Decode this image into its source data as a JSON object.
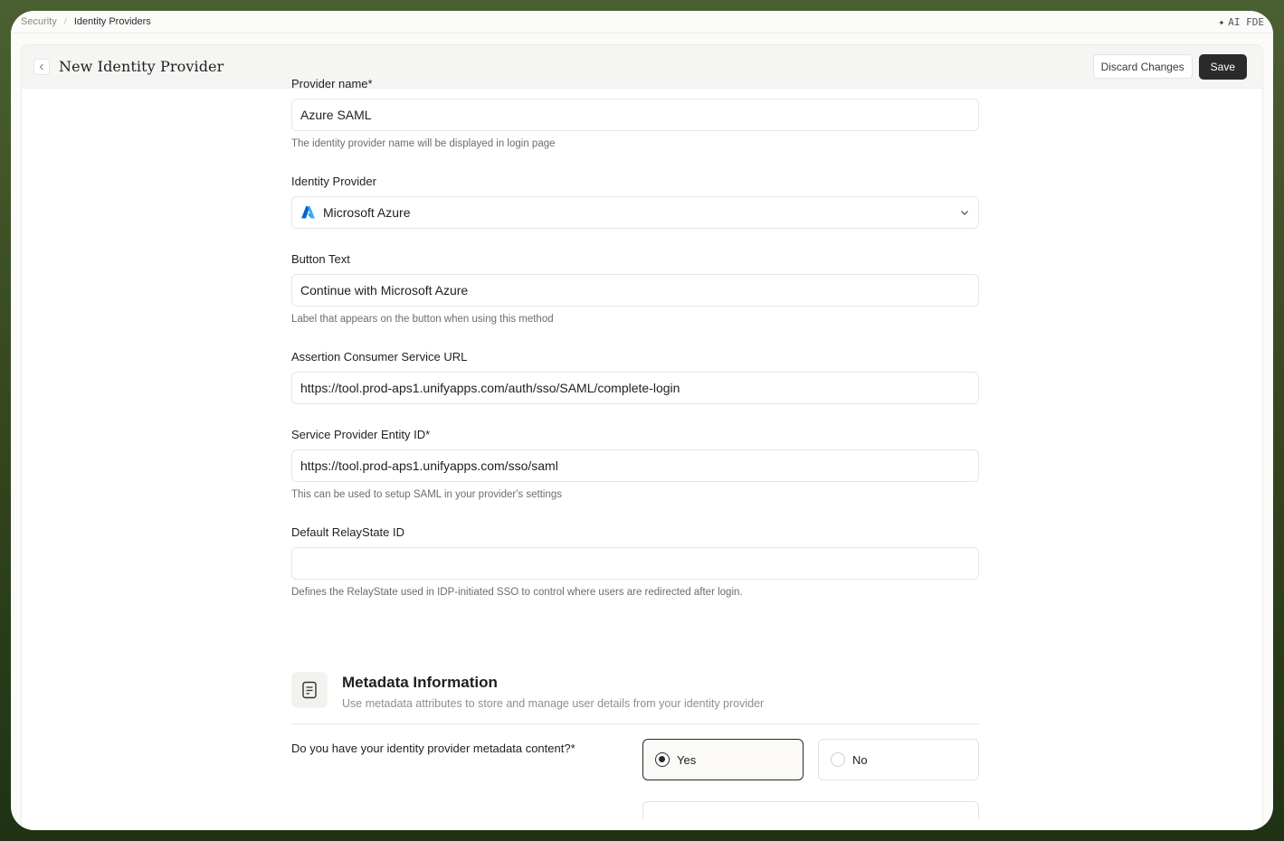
{
  "breadcrumb": {
    "parent": "Security",
    "separator": "/",
    "current": "Identity Providers"
  },
  "ai_badge": {
    "icon": "sparkle-icon",
    "label": "AI FDE"
  },
  "header": {
    "title": "New Identity Provider",
    "discard_label": "Discard Changes",
    "save_label": "Save"
  },
  "form": {
    "provider_name": {
      "label": "Provider name*",
      "value": "Azure SAML",
      "hint": "The identity provider name will be displayed in login page"
    },
    "identity_provider": {
      "label": "Identity Provider",
      "selected": "Microsoft Azure",
      "icon": "microsoft-azure-logo"
    },
    "button_text": {
      "label": "Button Text",
      "value": "Continue with Microsoft Azure",
      "hint": "Label that appears on the button when using this method"
    },
    "acs_url": {
      "label": "Assertion Consumer Service URL",
      "value": "https://tool.prod-aps1.unifyapps.com/auth/sso/SAML/complete-login"
    },
    "sp_entity_id": {
      "label": "Service Provider Entity ID*",
      "value": "https://tool.prod-aps1.unifyapps.com/sso/saml",
      "hint": "This can be used to setup SAML in your provider's settings"
    },
    "relay_state": {
      "label": "Default RelayState ID",
      "value": "",
      "hint": "Defines the RelayState used in IDP-initiated SSO to control where users are redirected after login."
    }
  },
  "metadata": {
    "icon": "document-icon",
    "title": "Metadata Information",
    "description": "Use metadata attributes to store and manage user details from your identity provider",
    "question": "Do you have your identity provider metadata content?*",
    "options": [
      {
        "label": "Yes",
        "selected": true
      },
      {
        "label": "No",
        "selected": false
      }
    ]
  },
  "colors": {
    "primary_button": "#2a2a2a",
    "azure_blue": "#0078d4",
    "background_green": "#3d5226"
  }
}
